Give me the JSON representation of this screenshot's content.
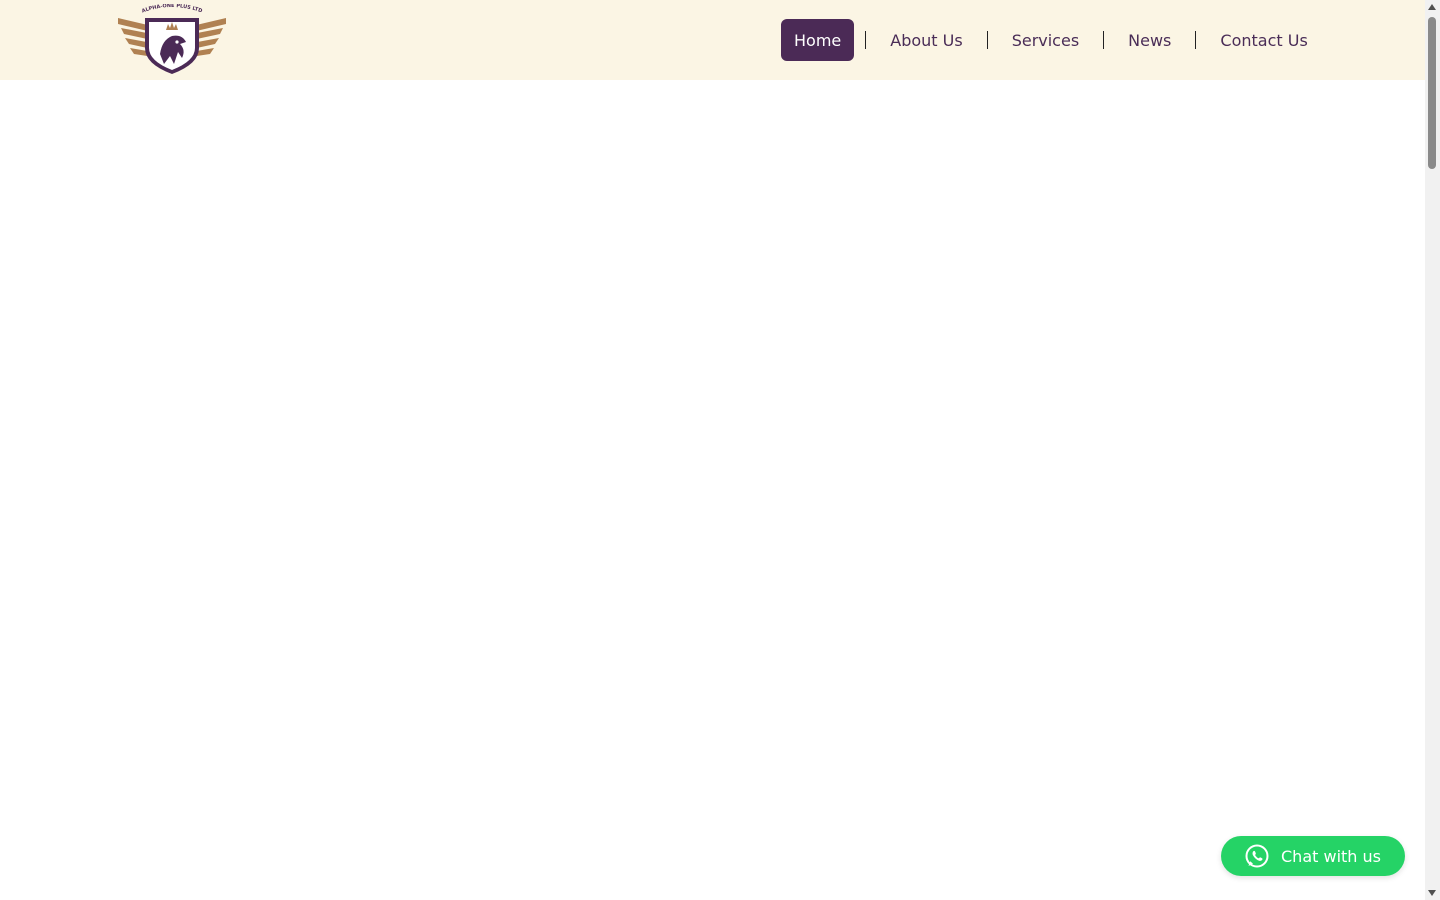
{
  "header": {
    "logo_text": "ALPHA-ONE PLUS LTD",
    "nav": [
      {
        "label": "Home",
        "active": true
      },
      {
        "label": "About Us",
        "active": false
      },
      {
        "label": "Services",
        "active": false
      },
      {
        "label": "News",
        "active": false
      },
      {
        "label": "Contact Us",
        "active": false
      }
    ]
  },
  "chat": {
    "label": "Chat with us",
    "icon": "whatsapp-icon"
  },
  "colors": {
    "header_bg": "#fbf5e4",
    "brand_purple": "#4b2a56",
    "whatsapp_green": "#25d366",
    "logo_gold": "#b08152"
  }
}
